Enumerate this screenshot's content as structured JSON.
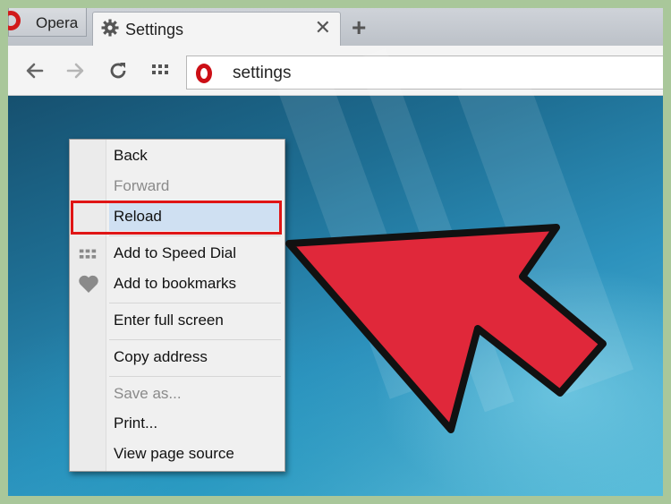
{
  "tabs": {
    "opera_label": "Opera",
    "active_label": "Settings"
  },
  "toolbar": {
    "address": "settings"
  },
  "context_menu": {
    "items": [
      {
        "label": "Back",
        "enabled": true
      },
      {
        "label": "Forward",
        "enabled": false
      },
      {
        "label": "Reload",
        "enabled": true,
        "highlighted": true
      },
      {
        "label": "Add to Speed Dial",
        "enabled": true,
        "icon": "speed-dial-icon"
      },
      {
        "label": "Add to bookmarks",
        "enabled": true,
        "icon": "heart-icon"
      },
      {
        "label": "Enter full screen",
        "enabled": true
      },
      {
        "label": "Copy address",
        "enabled": true
      },
      {
        "label": "Save as...",
        "enabled": false
      },
      {
        "label": "Print...",
        "enabled": true
      },
      {
        "label": "View page source",
        "enabled": true
      }
    ]
  },
  "colors": {
    "opera_red": "#cc0f16",
    "annotation_red": "#e01515",
    "arrow_fill": "#e0283a",
    "menu_highlight": "#cfe0f2"
  }
}
